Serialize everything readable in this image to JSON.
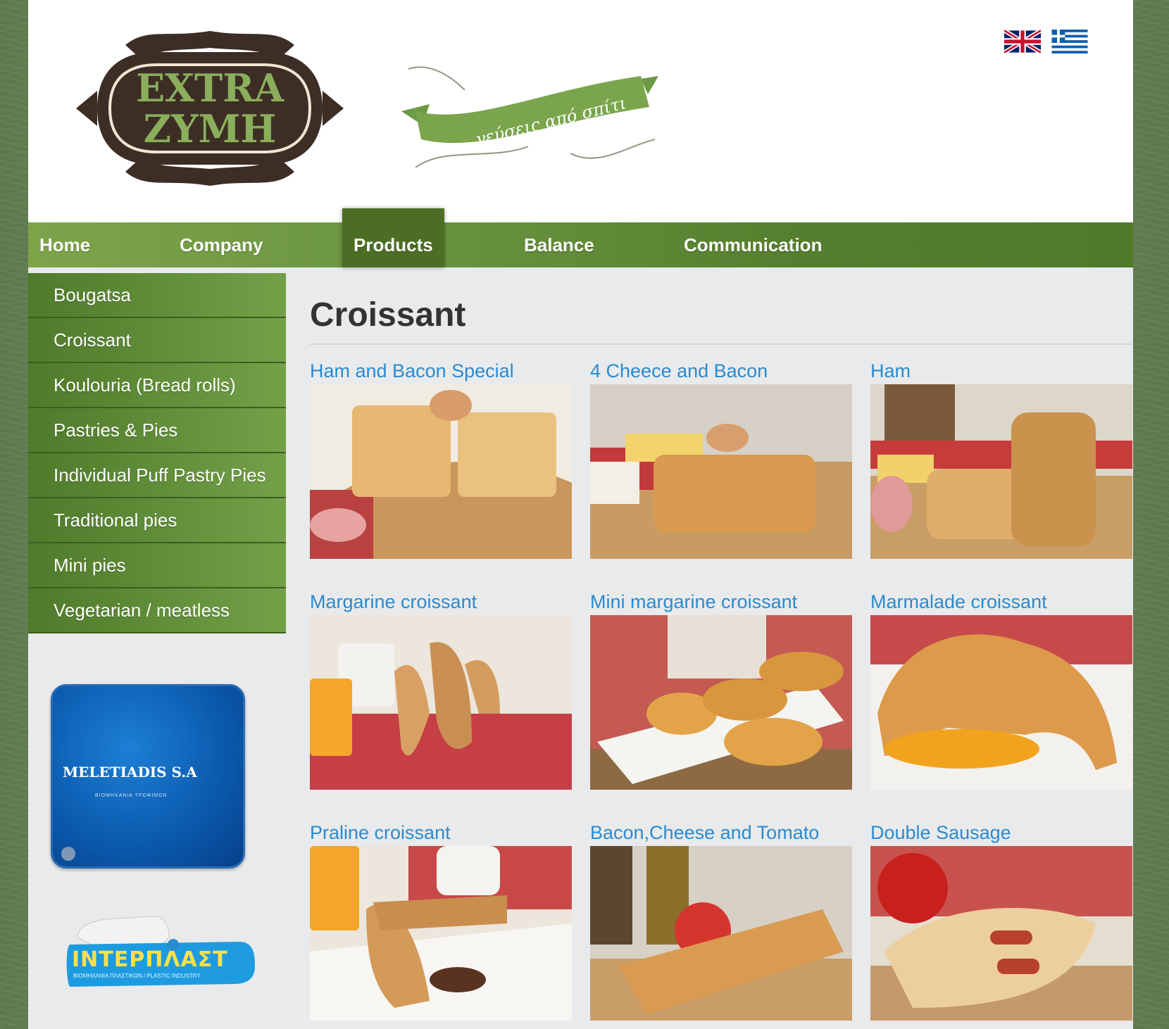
{
  "header": {
    "logo_line1": "EXTRA",
    "logo_line2": "ΖΥΜΗ",
    "tagline": "γεύσεις από σπίτι",
    "languages": [
      {
        "name": "English",
        "icon": "uk-flag-icon"
      },
      {
        "name": "Ελληνικά",
        "icon": "greek-flag-icon"
      }
    ]
  },
  "nav": {
    "items": [
      {
        "label": "Home"
      },
      {
        "label": "Company"
      },
      {
        "label": "Products"
      },
      {
        "label": "Balance"
      },
      {
        "label": "Communication"
      }
    ],
    "active": "Products"
  },
  "sidebar": {
    "items": [
      {
        "label": "Bougatsa"
      },
      {
        "label": "Croissant"
      },
      {
        "label": "Koulouria (Bread rolls)"
      },
      {
        "label": "Pastries & Pies"
      },
      {
        "label": "Individual Puff Pastry Pies"
      },
      {
        "label": "Traditional pies"
      },
      {
        "label": "Mini pies"
      },
      {
        "label": "Vegetarian / meatless"
      }
    ],
    "ads": {
      "meletiadis": {
        "name": "MELETIADIS S.A",
        "subtitle": "ΒΙΟΜΗΧΑΝΙΑ ΤΡΟΦΙΜΩΝ"
      },
      "interplast": {
        "name": "ΙΝΤΕΡΠΛΑΣΤ",
        "subtitle": "ΒΙΟΜΗΧΑΝΙΑ ΠΛΑΣΤΙΚΩΝ / PLASTIC INDUSTRY"
      }
    }
  },
  "main": {
    "title": "Croissant",
    "products": [
      {
        "name": "Ham and Bacon Special"
      },
      {
        "name": "4 Cheece and Bacon"
      },
      {
        "name": "Ham"
      },
      {
        "name": "Margarine croissant"
      },
      {
        "name": "Mini margarine croissant"
      },
      {
        "name": "Marmalade croissant"
      },
      {
        "name": "Praline croissant"
      },
      {
        "name": "Bacon,Cheese and Tomato"
      },
      {
        "name": "Double Sausage"
      }
    ]
  },
  "colors": {
    "nav_green": "#6a9440",
    "nav_active": "#4b6e24",
    "link_blue": "#2a8bd0",
    "logo_brown": "#3d2e25",
    "logo_green": "#8aae5c"
  }
}
